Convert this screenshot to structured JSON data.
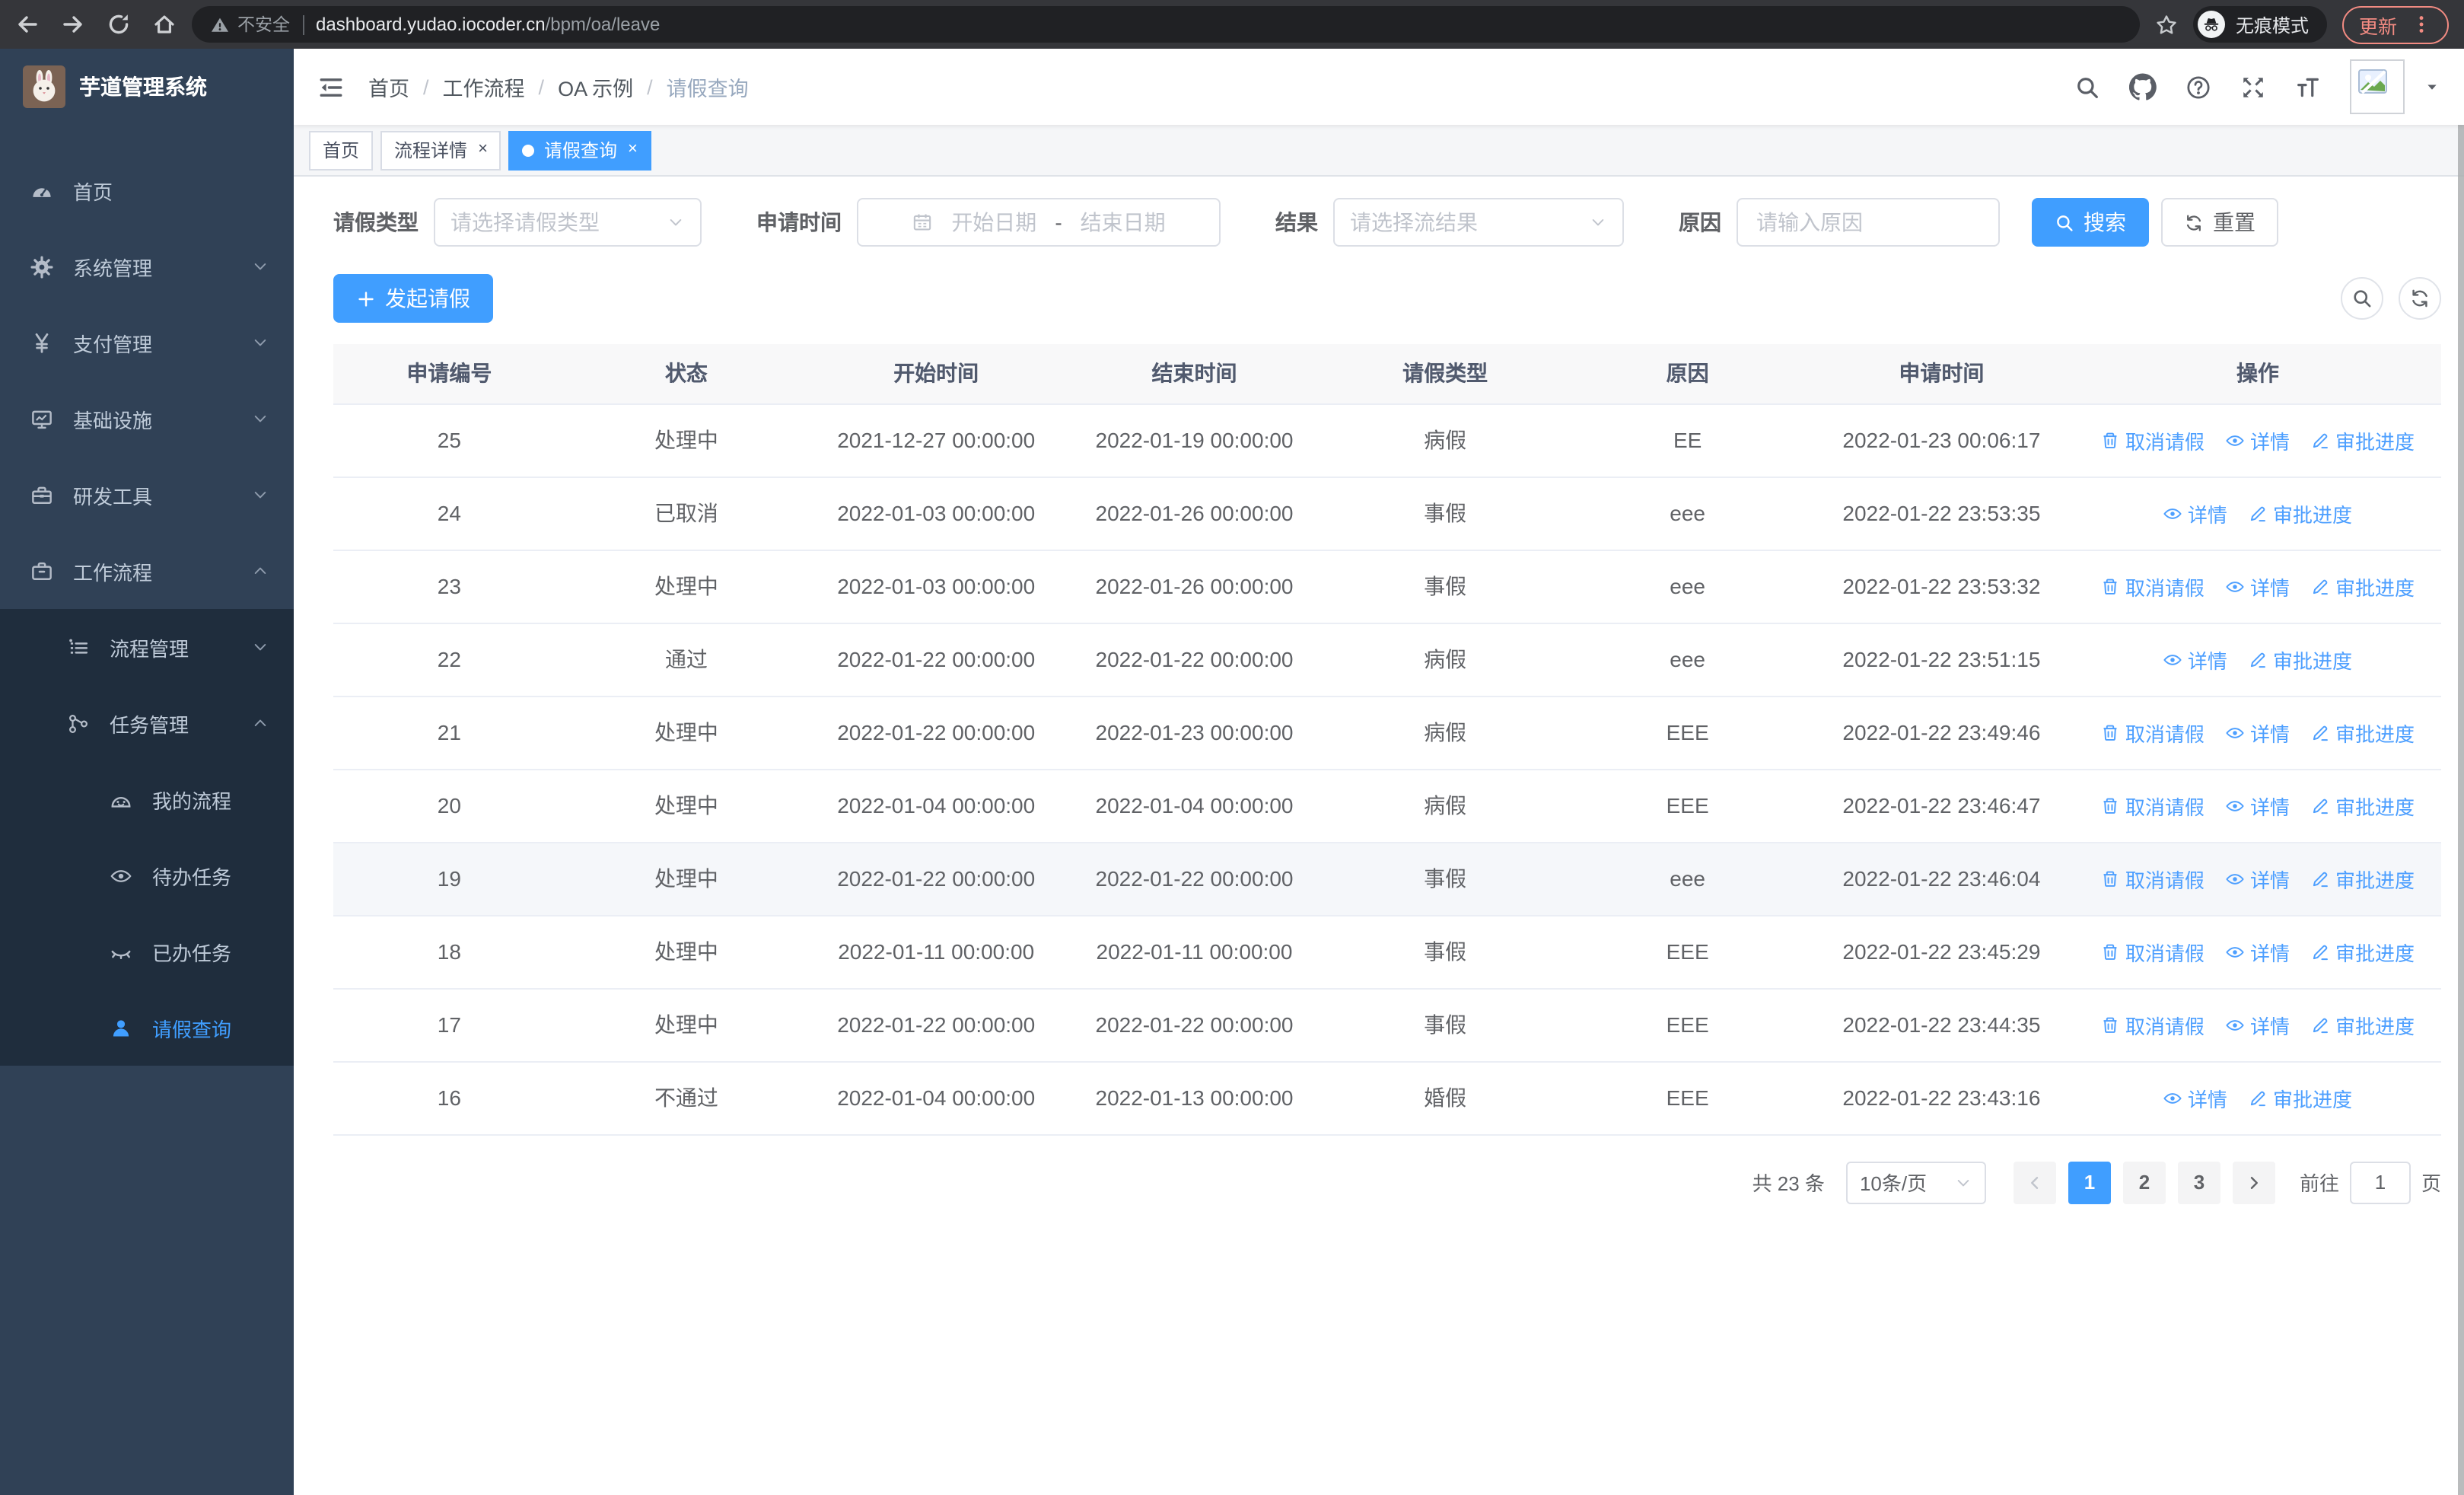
{
  "browser": {
    "security_label": "不安全",
    "url_host": "dashboard.yudao.iocoder.cn",
    "url_path": "/bpm/oa/leave",
    "incognito_label": "无痕模式",
    "update_label": "更新"
  },
  "sidebar": {
    "title": "芋道管理系统",
    "items": [
      {
        "id": "home",
        "icon": "dashboard-icon",
        "label": "首页",
        "level": 0,
        "chevron": null,
        "dark": false,
        "active": false
      },
      {
        "id": "system",
        "icon": "gear-icon",
        "label": "系统管理",
        "level": 0,
        "chevron": "down",
        "dark": false,
        "active": false
      },
      {
        "id": "payment",
        "icon": "yen-icon",
        "label": "支付管理",
        "level": 0,
        "chevron": "down",
        "dark": false,
        "active": false
      },
      {
        "id": "infra",
        "icon": "monitor-icon",
        "label": "基础设施",
        "level": 0,
        "chevron": "down",
        "dark": false,
        "active": false
      },
      {
        "id": "devtools",
        "icon": "toolbox-icon",
        "label": "研发工具",
        "level": 0,
        "chevron": "down",
        "dark": false,
        "active": false
      },
      {
        "id": "workflow",
        "icon": "briefcase-icon",
        "label": "工作流程",
        "level": 0,
        "chevron": "up",
        "dark": false,
        "active": false
      },
      {
        "id": "process-mgmt",
        "icon": "list-icon",
        "label": "流程管理",
        "level": 1,
        "chevron": "down",
        "dark": true,
        "active": false
      },
      {
        "id": "task-mgmt",
        "icon": "flow-icon",
        "label": "任务管理",
        "level": 1,
        "chevron": "up",
        "dark": true,
        "active": false
      },
      {
        "id": "my-process",
        "icon": "face-icon",
        "label": "我的流程",
        "level": 2,
        "chevron": null,
        "dark": true,
        "active": false
      },
      {
        "id": "todo-tasks",
        "icon": "eye-icon",
        "label": "待办任务",
        "level": 2,
        "chevron": null,
        "dark": true,
        "active": false
      },
      {
        "id": "done-tasks",
        "icon": "eye-closed-icon",
        "label": "已办任务",
        "level": 2,
        "chevron": null,
        "dark": true,
        "active": false
      },
      {
        "id": "leave-query",
        "icon": "person-icon",
        "label": "请假查询",
        "level": 2,
        "chevron": null,
        "dark": true,
        "active": true
      }
    ]
  },
  "breadcrumb": [
    "首页",
    "工作流程",
    "OA 示例",
    "请假查询"
  ],
  "header_actions": [
    {
      "id": "search",
      "icon": "search-icon"
    },
    {
      "id": "github",
      "icon": "github-icon"
    },
    {
      "id": "help",
      "icon": "help-icon"
    },
    {
      "id": "fullscreen",
      "icon": "fullscreen-icon"
    },
    {
      "id": "font-size",
      "icon": "font-size-icon"
    }
  ],
  "tabs": [
    {
      "label": "首页",
      "closable": false,
      "active": false
    },
    {
      "label": "流程详情",
      "closable": true,
      "active": false
    },
    {
      "label": "请假查询",
      "closable": true,
      "active": true
    }
  ],
  "filters": {
    "leave_type": {
      "label": "请假类型",
      "placeholder": "请选择请假类型"
    },
    "apply_time": {
      "label": "申请时间",
      "start_placeholder": "开始日期",
      "separator": "-",
      "end_placeholder": "结束日期"
    },
    "result": {
      "label": "结果",
      "placeholder": "请选择流结果"
    },
    "reason": {
      "label": "原因",
      "placeholder": "请输入原因"
    },
    "search_label": "搜索",
    "reset_label": "重置"
  },
  "toolbar": {
    "create_label": "发起请假"
  },
  "table": {
    "columns": [
      "申请编号",
      "状态",
      "开始时间",
      "结束时间",
      "请假类型",
      "原因",
      "申请时间",
      "操作"
    ],
    "action_defs": {
      "cancel": {
        "label": "取消请假",
        "icon": "trash-icon"
      },
      "detail": {
        "label": "详情",
        "icon": "eye-icon"
      },
      "progress": {
        "label": "审批进度",
        "icon": "pen-icon"
      }
    },
    "rows": [
      {
        "id": "25",
        "status": "处理中",
        "start": "2021-12-27 00:00:00",
        "end": "2022-01-19 00:00:00",
        "type": "病假",
        "reason": "EE",
        "applied": "2022-01-23 00:06:17",
        "actions": [
          "cancel",
          "detail",
          "progress"
        ],
        "highlighted": false
      },
      {
        "id": "24",
        "status": "已取消",
        "start": "2022-01-03 00:00:00",
        "end": "2022-01-26 00:00:00",
        "type": "事假",
        "reason": "eee",
        "applied": "2022-01-22 23:53:35",
        "actions": [
          "detail",
          "progress"
        ],
        "highlighted": false
      },
      {
        "id": "23",
        "status": "处理中",
        "start": "2022-01-03 00:00:00",
        "end": "2022-01-26 00:00:00",
        "type": "事假",
        "reason": "eee",
        "applied": "2022-01-22 23:53:32",
        "actions": [
          "cancel",
          "detail",
          "progress"
        ],
        "highlighted": false
      },
      {
        "id": "22",
        "status": "通过",
        "start": "2022-01-22 00:00:00",
        "end": "2022-01-22 00:00:00",
        "type": "病假",
        "reason": "eee",
        "applied": "2022-01-22 23:51:15",
        "actions": [
          "detail",
          "progress"
        ],
        "highlighted": false
      },
      {
        "id": "21",
        "status": "处理中",
        "start": "2022-01-22 00:00:00",
        "end": "2022-01-23 00:00:00",
        "type": "病假",
        "reason": "EEE",
        "applied": "2022-01-22 23:49:46",
        "actions": [
          "cancel",
          "detail",
          "progress"
        ],
        "highlighted": false
      },
      {
        "id": "20",
        "status": "处理中",
        "start": "2022-01-04 00:00:00",
        "end": "2022-01-04 00:00:00",
        "type": "病假",
        "reason": "EEE",
        "applied": "2022-01-22 23:46:47",
        "actions": [
          "cancel",
          "detail",
          "progress"
        ],
        "highlighted": false
      },
      {
        "id": "19",
        "status": "处理中",
        "start": "2022-01-22 00:00:00",
        "end": "2022-01-22 00:00:00",
        "type": "事假",
        "reason": "eee",
        "applied": "2022-01-22 23:46:04",
        "actions": [
          "cancel",
          "detail",
          "progress"
        ],
        "highlighted": true
      },
      {
        "id": "18",
        "status": "处理中",
        "start": "2022-01-11 00:00:00",
        "end": "2022-01-11 00:00:00",
        "type": "事假",
        "reason": "EEE",
        "applied": "2022-01-22 23:45:29",
        "actions": [
          "cancel",
          "detail",
          "progress"
        ],
        "highlighted": false
      },
      {
        "id": "17",
        "status": "处理中",
        "start": "2022-01-22 00:00:00",
        "end": "2022-01-22 00:00:00",
        "type": "事假",
        "reason": "EEE",
        "applied": "2022-01-22 23:44:35",
        "actions": [
          "cancel",
          "detail",
          "progress"
        ],
        "highlighted": false
      },
      {
        "id": "16",
        "status": "不通过",
        "start": "2022-01-04 00:00:00",
        "end": "2022-01-13 00:00:00",
        "type": "婚假",
        "reason": "EEE",
        "applied": "2022-01-22 23:43:16",
        "actions": [
          "detail",
          "progress"
        ],
        "highlighted": false
      }
    ]
  },
  "pagination": {
    "total_label": "共 23 条",
    "page_size_label": "10条/页",
    "pages": [
      "1",
      "2",
      "3"
    ],
    "active_page": "1",
    "goto_label": "前往",
    "goto_value": "1",
    "page_unit": "页"
  },
  "colors": {
    "primary": "#409eff",
    "link": "#4d9fff",
    "sidebar_bg": "#304156",
    "submenu_bg": "#1f2d3d",
    "update_accent": "#f28b82"
  }
}
